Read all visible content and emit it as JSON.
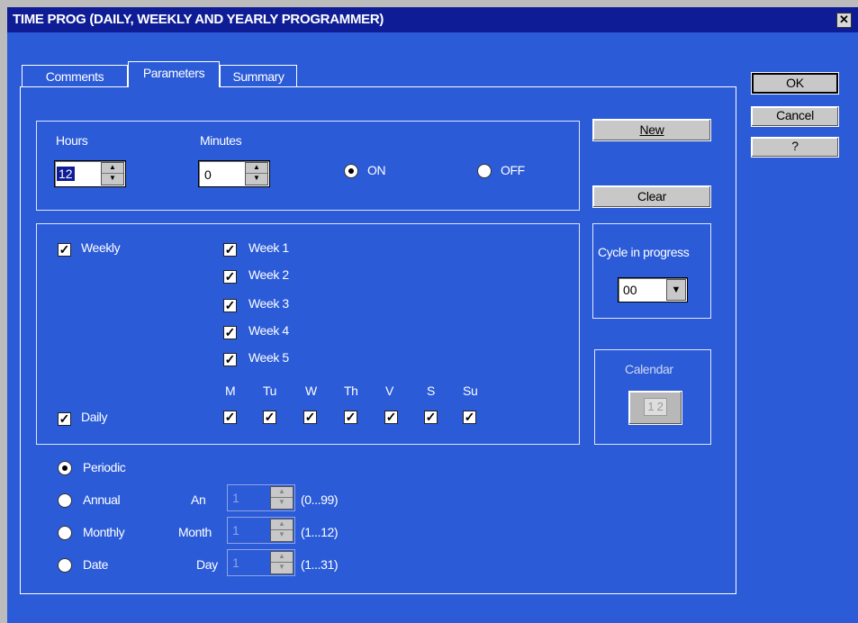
{
  "window": {
    "title": "TIME PROG (DAILY, WEEKLY AND YEARLY PROGRAMMER)",
    "close_glyph": "✕"
  },
  "tabs": [
    {
      "label": "Comments"
    },
    {
      "label": "Parameters",
      "active": true
    },
    {
      "label": "Summary"
    }
  ],
  "dialog_buttons": {
    "ok": "OK",
    "cancel": "Cancel",
    "help": "?"
  },
  "time": {
    "hours_label": "Hours",
    "hours_value": "12",
    "minutes_label": "Minutes",
    "minutes_value": "0",
    "on_label": "ON",
    "off_label": "OFF",
    "selected": "ON"
  },
  "actions": {
    "new": "New",
    "clear": "Clear"
  },
  "weekly": {
    "label": "Weekly",
    "checked": true,
    "weeks": [
      {
        "label": "Week 1",
        "checked": true
      },
      {
        "label": "Week 2",
        "checked": true
      },
      {
        "label": "Week 3",
        "checked": true
      },
      {
        "label": "Week 4",
        "checked": true
      },
      {
        "label": "Week 5",
        "checked": true
      }
    ]
  },
  "daily": {
    "label": "Daily",
    "checked": true,
    "days": [
      {
        "label": "M",
        "checked": true
      },
      {
        "label": "Tu",
        "checked": true
      },
      {
        "label": "W",
        "checked": true
      },
      {
        "label": "Th",
        "checked": true
      },
      {
        "label": "V",
        "checked": true
      },
      {
        "label": "S",
        "checked": true
      },
      {
        "label": "Su",
        "checked": true
      }
    ]
  },
  "cycle": {
    "label": "Cycle in progress",
    "value": "00"
  },
  "calendar": {
    "label": "Calendar",
    "icon_text": "1 2"
  },
  "mode": {
    "selected": "Periodic",
    "options": [
      {
        "label": "Periodic"
      },
      {
        "label": "Annual",
        "field_label": "An",
        "value": "1",
        "range": "(0...99)"
      },
      {
        "label": "Monthly",
        "field_label": "Month",
        "value": "1",
        "range": "(1...12)"
      },
      {
        "label": "Date",
        "field_label": "Day",
        "value": "1",
        "range": "(1...31)"
      }
    ]
  },
  "colors": {
    "window_bg": "#2b5bd7",
    "titlebar": "#0e1d96",
    "button_face": "#c8c8c8"
  }
}
